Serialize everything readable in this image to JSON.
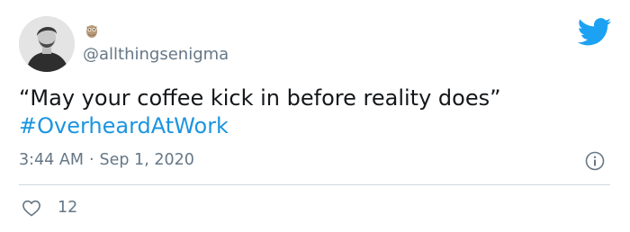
{
  "tweet": {
    "handle": "@allthingsenigma",
    "text": "“May your coffee kick in before reality does”",
    "hashtag": "#OverheardAtWork",
    "time": "3:44 AM",
    "date": "Sep 1, 2020",
    "separator": "·",
    "like_count": "12"
  },
  "icons": {
    "name_emoji": "owl-emoji-icon",
    "brand": "twitter-bird-icon",
    "info": "info-icon",
    "like": "heart-icon"
  },
  "colors": {
    "brand_blue": "#1da1f2",
    "hashtag_blue": "#1b95e0",
    "secondary_text": "#657786",
    "primary_text": "#14171a",
    "divider": "#cfd9de"
  }
}
